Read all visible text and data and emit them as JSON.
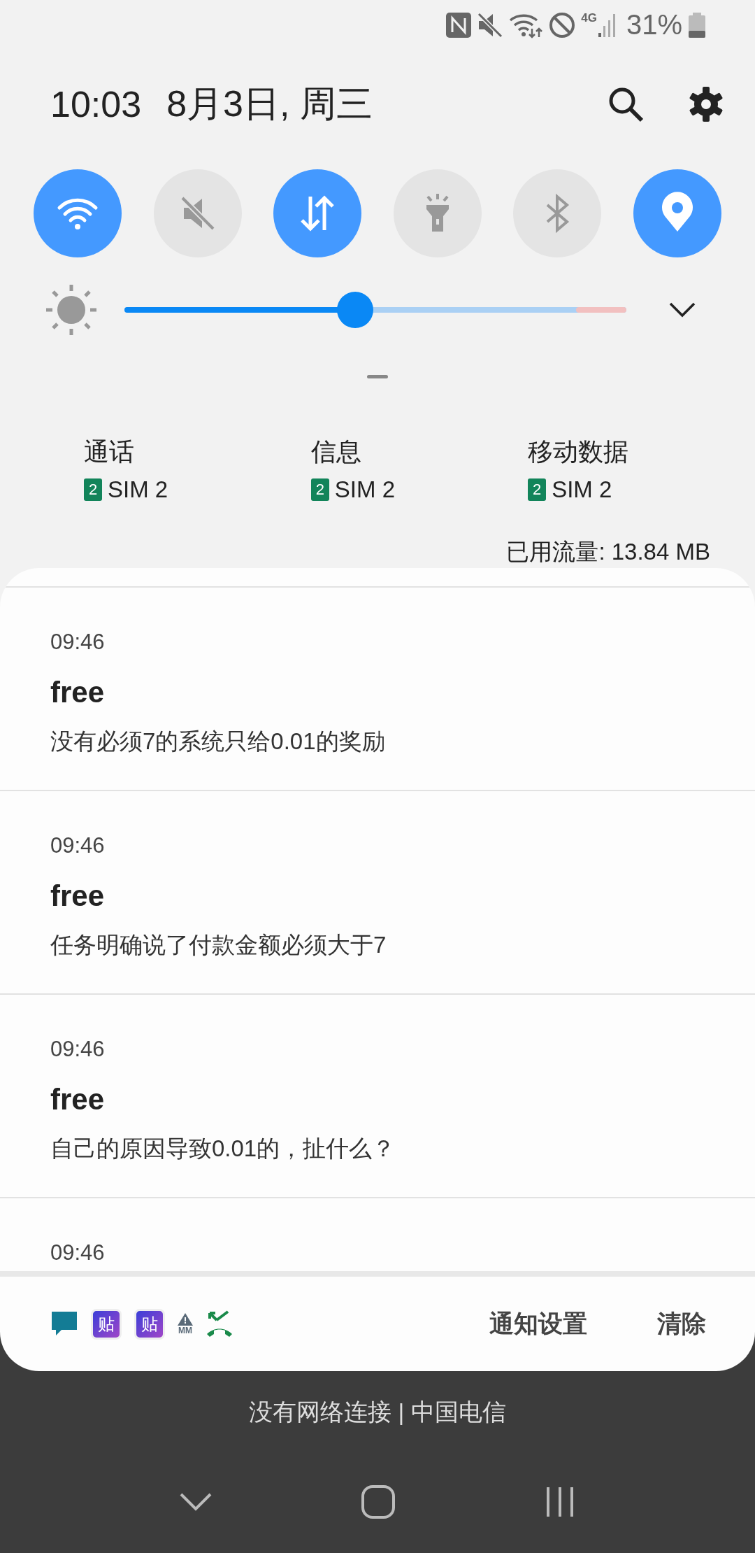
{
  "status_bar": {
    "network_type": "4G",
    "battery": "31%"
  },
  "header": {
    "time": "10:03",
    "date": "8月3日, 周三"
  },
  "quick_toggles": [
    {
      "kind": "wifi",
      "on": true
    },
    {
      "kind": "sound",
      "on": false
    },
    {
      "kind": "data",
      "on": true
    },
    {
      "kind": "flashlight",
      "on": false
    },
    {
      "kind": "bluetooth",
      "on": false
    },
    {
      "kind": "location",
      "on": true
    }
  ],
  "brightness": {
    "level": 0.46
  },
  "sim_info": [
    {
      "label": "通话",
      "sim_badge": "2",
      "sim": "SIM 2"
    },
    {
      "label": "信息",
      "sim_badge": "2",
      "sim": "SIM 2"
    },
    {
      "label": "移动数据",
      "sim_badge": "2",
      "sim": "SIM 2"
    }
  ],
  "data_usage": "已用流量: 13.84 MB",
  "notifications": [
    {
      "time": "09:46",
      "title": "free",
      "body": "没有必须7的系统只给0.01的奖励"
    },
    {
      "time": "09:46",
      "title": "free",
      "body": "任务明确说了付款金额必须大于7"
    },
    {
      "time": "09:46",
      "title": "free",
      "body": "自己的原因导致0.01的，扯什么？"
    },
    {
      "time": "09:46"
    }
  ],
  "footer": {
    "app_icons": [
      {
        "kind": "message"
      },
      {
        "kind": "tieba",
        "label": "贴"
      },
      {
        "kind": "tieba",
        "label": "贴"
      },
      {
        "kind": "mm",
        "label": "MM"
      },
      {
        "kind": "missed_call"
      }
    ],
    "buttons": [
      "通知设置",
      "清除"
    ]
  },
  "carrier_text": "没有网络连接 | 中国电信"
}
